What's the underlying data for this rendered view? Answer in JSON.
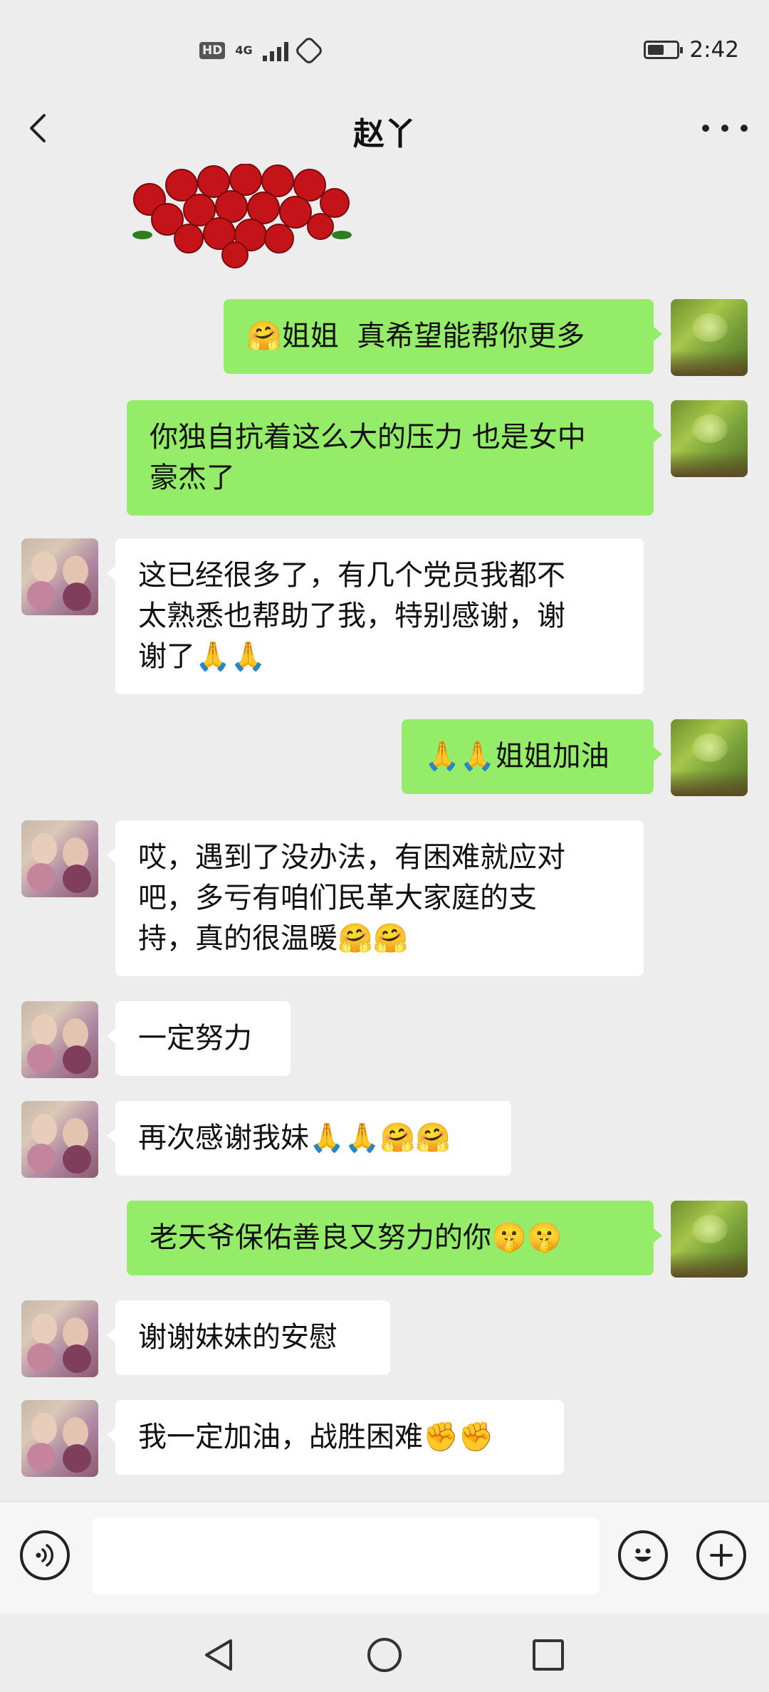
{
  "status_bar": {
    "hd": "HD",
    "network": "4G",
    "time": "2:42"
  },
  "header": {
    "title": "赵丫"
  },
  "messages": [
    {
      "side": "right",
      "text": "🤗姐姐  真希望能帮你更多"
    },
    {
      "side": "right",
      "text": "你独自抗着这么大的压力 也是女中\n豪杰了"
    },
    {
      "side": "left",
      "text": "这已经很多了，有几个党员我都不\n太熟悉也帮助了我，特别感谢，谢\n谢了🙏🙏"
    },
    {
      "side": "right",
      "text": "🙏🙏姐姐加油"
    },
    {
      "side": "left",
      "text": "哎，遇到了没办法，有困难就应对\n吧，多亏有咱们民革大家庭的支\n持，真的很温暖🤗🤗"
    },
    {
      "side": "left",
      "text": "一定努力"
    },
    {
      "side": "left",
      "text": "再次感谢我妹🙏🙏🤗🤗"
    },
    {
      "side": "right",
      "text": "老天爷保佑善良又努力的你🤫🤫"
    },
    {
      "side": "left",
      "text": "谢谢妹妹的安慰"
    },
    {
      "side": "left",
      "text": "我一定加油，战胜困难✊✊"
    }
  ],
  "icons": {
    "back": "back-arrow-icon",
    "more": "more-dots-icon",
    "voice": "voice-icon",
    "emoji": "emoji-icon",
    "plus": "plus-icon",
    "nav_back": "nav-back-icon",
    "nav_home": "nav-home-icon",
    "nav_recents": "nav-recents-icon"
  },
  "colors": {
    "sent_bubble": "#95ec69",
    "received_bubble": "#ffffff",
    "background": "#ededed"
  }
}
